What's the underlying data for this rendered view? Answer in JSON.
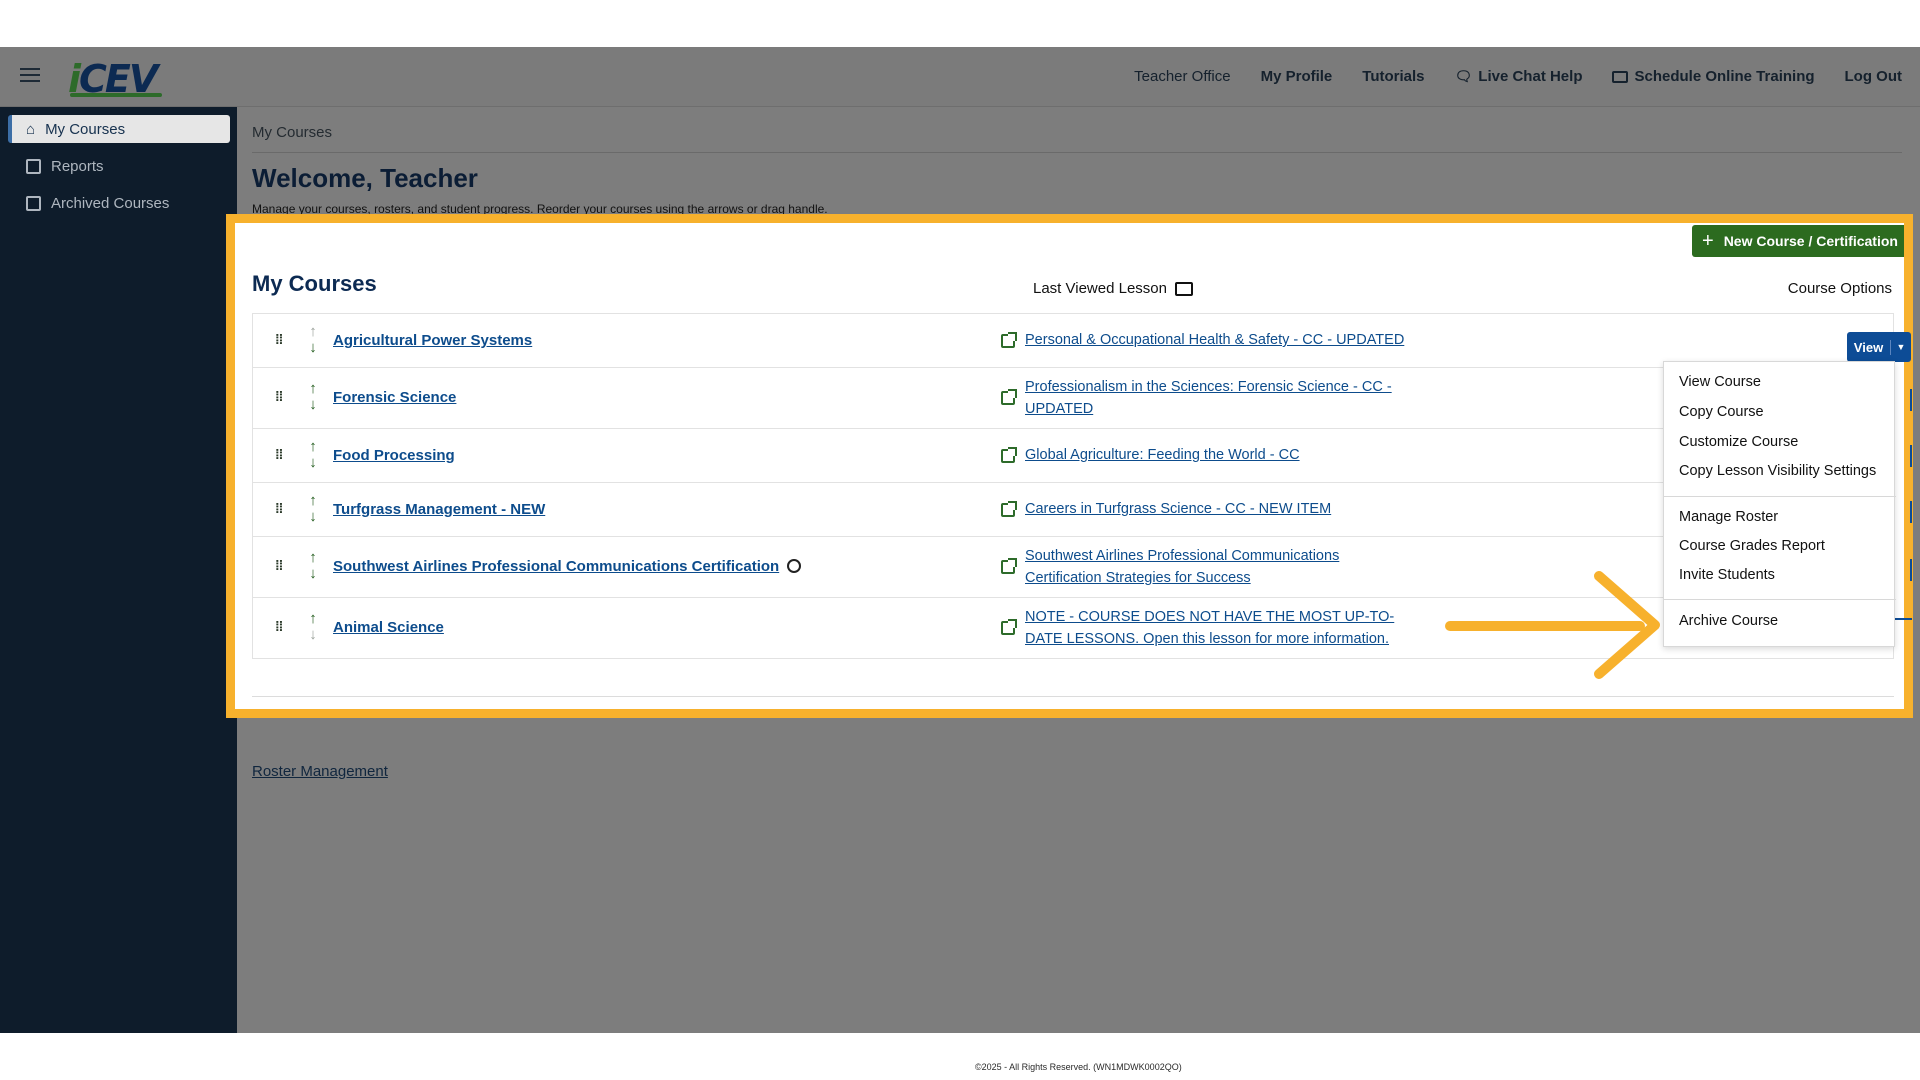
{
  "header": {
    "logo": "iCEV",
    "nav": [
      {
        "label": "Teacher Office",
        "bold": false
      },
      {
        "label": "My Profile",
        "bold": true
      },
      {
        "label": "Tutorials",
        "bold": true
      },
      {
        "label": "Live Chat Help",
        "bold": true,
        "icon": "chat-icon"
      },
      {
        "label": "Schedule Online Training",
        "bold": true,
        "icon": "laptop-icon"
      },
      {
        "label": "Log Out",
        "bold": true
      }
    ]
  },
  "sidebar": {
    "items": [
      {
        "label": "My Courses",
        "icon": "home-icon",
        "active": true
      },
      {
        "label": "Reports",
        "icon": "chart-icon",
        "active": false
      },
      {
        "label": "Archived Courses",
        "icon": "archive-icon",
        "active": false
      }
    ]
  },
  "main": {
    "breadcrumb": "My Courses",
    "title": "Welcome, Teacher",
    "subtitle": "Manage your courses, rosters, and student progress. Reorder your courses using the arrows or drag handle.",
    "card": {
      "title": "My Courses",
      "new_course_label": "New Course / Certification",
      "last_viewed_label": "Last Viewed Lesson",
      "course_options_label": "Course Options",
      "view_label": "View"
    },
    "courses": [
      {
        "name": "Agricultural Power Systems",
        "lesson": "Personal & Occupational Health & Safety - CC - UPDATED"
      },
      {
        "name": "Forensic Science",
        "lesson": "Professionalism in the Sciences: Forensic Science - CC - UPDATED"
      },
      {
        "name": "Food Processing",
        "lesson": "Global Agriculture: Feeding the World - CC"
      },
      {
        "name": "Turfgrass Management - NEW",
        "lesson": "Careers in Turfgrass Science - CC - NEW ITEM"
      },
      {
        "name": "Southwest Airlines Professional Communications Certification",
        "lesson": "Southwest Airlines Professional Communications Certification Strategies for Success",
        "badge": true
      },
      {
        "name": "Animal Science",
        "lesson": "NOTE - COURSE DOES NOT HAVE THE MOST UP-TO-DATE LESSONS. Open this lesson for more information."
      }
    ],
    "menu": {
      "items": [
        "View Course",
        "Copy Course",
        "Customize Course",
        "Copy Lesson Visibility Settings",
        "Manage Roster",
        "Course Grades Report",
        "Invite Students",
        "Archive Course"
      ]
    },
    "roster_link": "Roster Management",
    "footer": "©2025 - All Rights Reserved. (WN1MDWK0002QO)"
  },
  "colors": {
    "highlight": "#f7b12d",
    "primary_blue": "#0d4c96",
    "new_course_green": "#2c6b1f",
    "sidebar_bg": "#0e1c2b"
  }
}
